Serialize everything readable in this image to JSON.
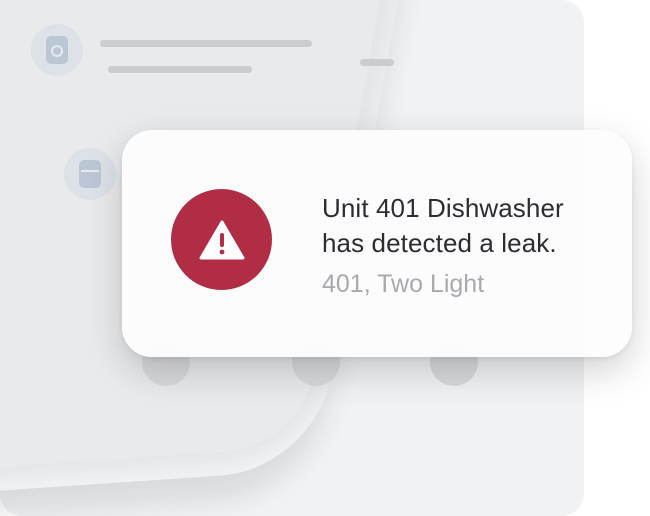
{
  "notification": {
    "title_line1": "Unit 401 Dishwasher",
    "title_line2": "has detected a leak.",
    "subtitle": "401, Two Light",
    "icon": "warning-triangle-icon",
    "accent_color": "#b02d45"
  },
  "phone_list": {
    "row_icons": [
      "washer-icon",
      "fridge-icon"
    ]
  }
}
